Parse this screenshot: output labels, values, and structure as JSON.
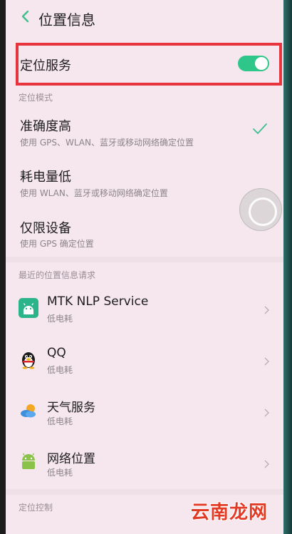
{
  "header": {
    "title": "位置信息"
  },
  "location_service": {
    "label": "定位服务",
    "enabled": true
  },
  "location_mode": {
    "section_label": "定位模式",
    "options": [
      {
        "title": "准确度高",
        "desc": "使用 GPS、WLAN、蓝牙或移动网络确定位置",
        "selected": true
      },
      {
        "title": "耗电量低",
        "desc": "使用 WLAN、蓝牙或移动网络确定位置",
        "selected": false
      },
      {
        "title": "仅限设备",
        "desc": "使用 GPS 确定位置",
        "selected": false
      }
    ]
  },
  "recent_requests": {
    "section_label": "最近的位置信息请求",
    "apps": [
      {
        "name": "MTK NLP Service",
        "usage": "低电耗",
        "icon": "android-icon"
      },
      {
        "name": "QQ",
        "usage": "低电耗",
        "icon": "qq-penguin-icon"
      },
      {
        "name": "天气服务",
        "usage": "低电耗",
        "icon": "weather-icon"
      },
      {
        "name": "网络位置",
        "usage": "低电耗",
        "icon": "android-icon"
      }
    ]
  },
  "location_control": {
    "section_label": "定位控制"
  },
  "watermark": "云南龙网",
  "colors": {
    "toggle_on": "#2fc68a",
    "highlight": "#e8343c",
    "background": "#f6e6ee"
  }
}
